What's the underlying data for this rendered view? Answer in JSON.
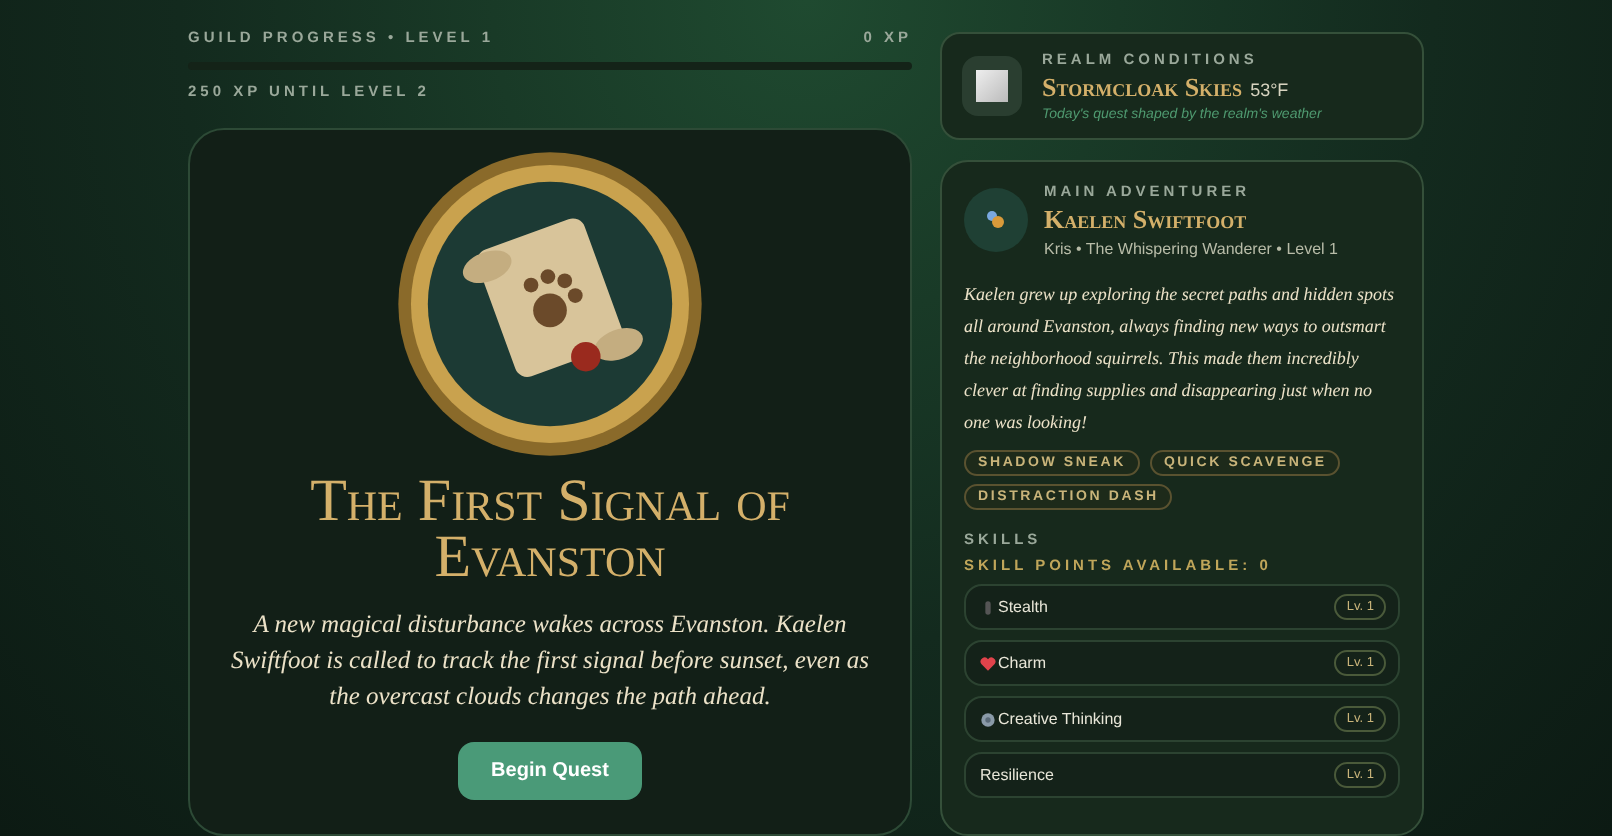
{
  "progress": {
    "label": "GUILD PROGRESS • LEVEL 1",
    "xp": "0 XP",
    "level": 0,
    "remaining": "250 XP UNTIL LEVEL 2"
  },
  "quest": {
    "title": "The First Signal of Evanston",
    "description": "A new magical disturbance wakes across Evanston. Kaelen Swiftfoot is called to track the first signal before sunset, even as the overcast clouds changes the path ahead.",
    "button": "Begin Quest"
  },
  "realm": {
    "eyebrow": "REALM CONDITIONS",
    "name": "Stormcloak Skies",
    "temperature": "53°F",
    "caption": "Today's quest shaped by the realm's weather"
  },
  "adventurer": {
    "eyebrow": "MAIN ADVENTURER",
    "name": "Kaelen Swiftfoot",
    "meta": "Kris • The Whispering Wanderer • Level 1",
    "bio": "Kaelen grew up exploring the secret paths and hidden spots all around Evanston, always finding new ways to outsmart the neighborhood squirrels. This made them incredibly clever at finding supplies and disappearing just when no one was looking!",
    "traits": [
      "SHADOW SNEAK",
      "QUICK SCAVENGE",
      "DISTRACTION DASH"
    ],
    "skills_heading": "SKILLS",
    "skill_points": "SKILL POINTS AVAILABLE: 0",
    "skills": [
      {
        "kind": "stealth",
        "name": "Stealth",
        "level": "Lv. 1"
      },
      {
        "kind": "charm",
        "name": "Charm",
        "level": "Lv. 1"
      },
      {
        "kind": "creative",
        "name": "Creative Thinking",
        "level": "Lv. 1"
      },
      {
        "kind": "plain",
        "name": "Resilience",
        "level": "Lv. 1"
      }
    ]
  }
}
